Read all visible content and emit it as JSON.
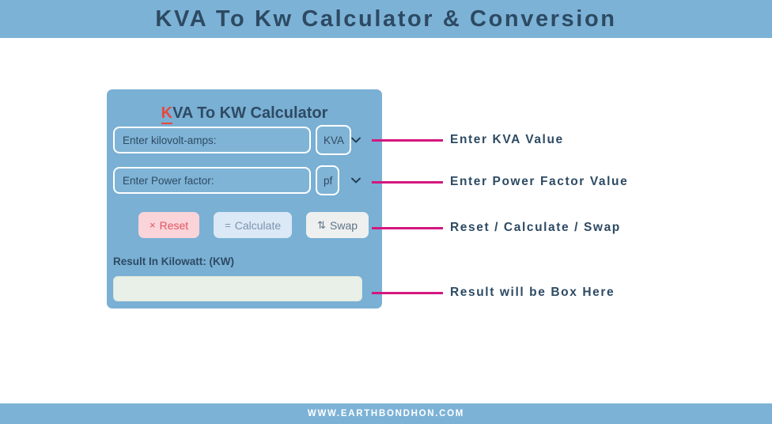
{
  "header": {
    "title": "KVA To Kw Calculator & Conversion",
    "bar_color": "#7cb2d6",
    "title_color": "#2d4a63"
  },
  "card": {
    "title_accent_letter": "K",
    "title_rest": "VA To KW Calculator",
    "accent_color": "#e9473d",
    "background_color": "#79b0d4",
    "fields": [
      {
        "name": "kilovolt-amps",
        "placeholder": "Enter kilovolt-amps:",
        "value": "",
        "unit_selected": "KVA",
        "unit_options": [
          "KVA"
        ]
      },
      {
        "name": "power-factor",
        "placeholder": "Enter Power factor:",
        "value": "",
        "unit_selected": "pf",
        "unit_options": [
          "pf"
        ]
      }
    ],
    "buttons": [
      {
        "name": "reset",
        "glyph": "×",
        "label": "Reset",
        "bg": "#fad4d8",
        "fg": "#e05561"
      },
      {
        "name": "calculate",
        "glyph": "=",
        "label": "Calculate",
        "bg": "#dbe8f6",
        "fg": "#7d95ae"
      },
      {
        "name": "swap",
        "glyph": "⇅",
        "label": "Swap",
        "bg": "#eef0ef",
        "fg": "#5d7488"
      }
    ],
    "result": {
      "label": "Result In Kilowatt: (KW)",
      "value": "",
      "box_color": "#e9f0e7"
    }
  },
  "annotations": {
    "line_color": "#d4177f",
    "items": [
      {
        "name": "kva-value",
        "text": "Enter KVA Value"
      },
      {
        "name": "power-factor-value",
        "text": "Enter Power Factor Value"
      },
      {
        "name": "buttons",
        "text": "Reset / Calculate / Swap"
      },
      {
        "name": "result-box",
        "text": "Result will be Box Here"
      }
    ]
  },
  "footer": {
    "text": "WWW.EARTHBONDHON.COM",
    "bar_color": "#7cb2d6"
  }
}
